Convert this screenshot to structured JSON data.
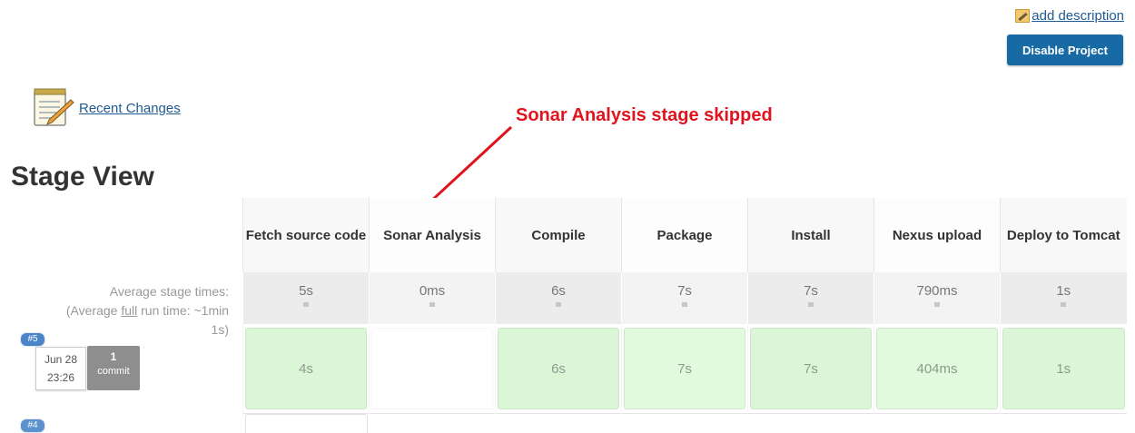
{
  "header": {
    "add_description": "add description",
    "disable_project": "Disable Project"
  },
  "recent_changes": "Recent Changes",
  "annotation": "Sonar Analysis stage skipped",
  "stage_view": {
    "title": "Stage View",
    "average_label_line1": "Average stage times:",
    "average_label_pre": "(Average ",
    "average_label_full": "full",
    "average_label_post": " run time: ~1min",
    "average_label_tail": "1s)",
    "stages": [
      {
        "name": "Fetch source code",
        "avg": "5s",
        "run5": "4s"
      },
      {
        "name": "Sonar Analysis",
        "avg": "0ms",
        "run5": ""
      },
      {
        "name": "Compile",
        "avg": "6s",
        "run5": "6s"
      },
      {
        "name": "Package",
        "avg": "7s",
        "run5": "7s"
      },
      {
        "name": "Install",
        "avg": "7s",
        "run5": "7s"
      },
      {
        "name": "Nexus upload",
        "avg": "790ms",
        "run5": "404ms"
      },
      {
        "name": "Deploy to Tomcat",
        "avg": "1s",
        "run5": "1s"
      }
    ],
    "runs": [
      {
        "id": "#5",
        "date": "Jun 28",
        "time": "23:26",
        "commits": "1",
        "commit_label": "commit"
      },
      {
        "id": "#4"
      }
    ]
  },
  "colors": {
    "accent": "#186aa5",
    "success_cell": "#dbf6d7",
    "annotation": "#e0141e"
  }
}
